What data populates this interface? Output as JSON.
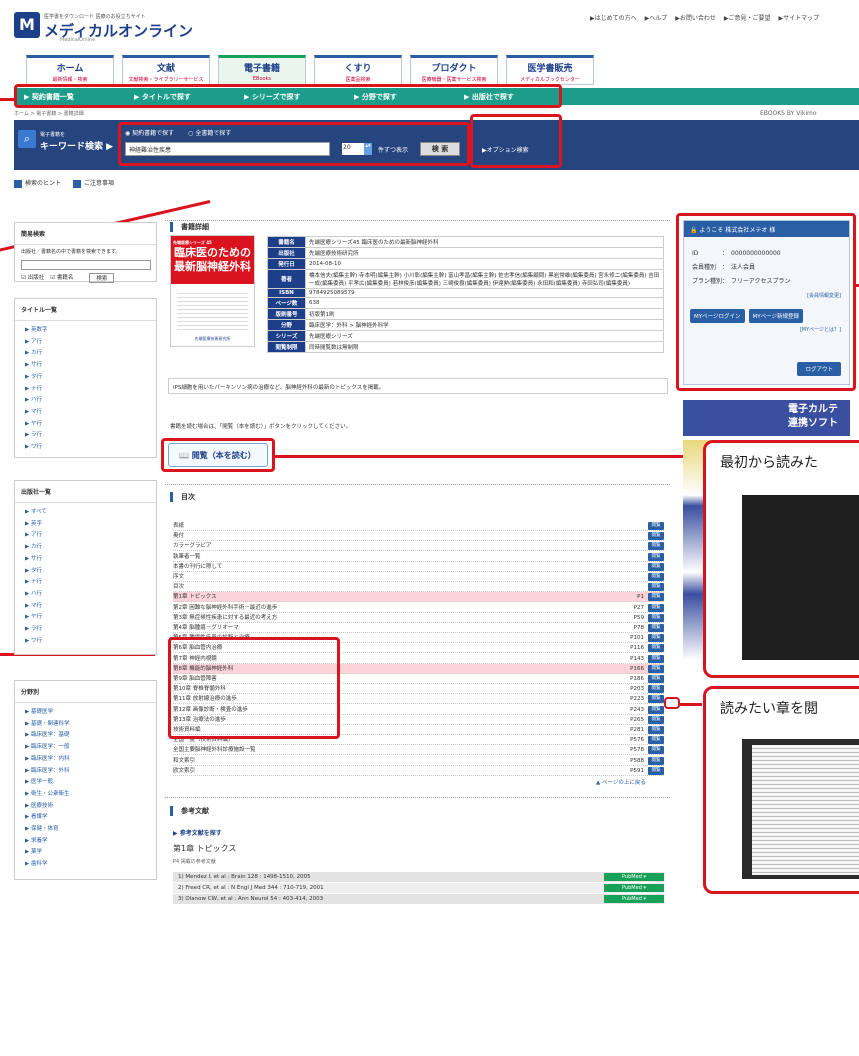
{
  "header": {
    "tagline": "医学書をダウンロード 医療のお役立ちサイト",
    "logo_mark": "M",
    "site_name": "メディカルオンライン",
    "site_sub": "MedicalOnline",
    "top_links": [
      "▶はじめての方へ",
      "▶ヘルプ",
      "▶お問い合わせ",
      "▶ご意見・ご要望",
      "▶サイトマップ"
    ]
  },
  "nav": {
    "tabs": [
      {
        "label": "ホーム",
        "sub": "最新情報・検索"
      },
      {
        "label": "文献",
        "sub": "文献検索・ライブラリーサービス"
      },
      {
        "label": "電子書籍",
        "sub": "EBooks"
      },
      {
        "label": "くすり",
        "sub": "医薬品検索"
      },
      {
        "label": "プロダクト",
        "sub": "医療機器・医薬サービス検索"
      },
      {
        "label": "医学書販売",
        "sub": "メディカルブックセンター"
      }
    ]
  },
  "subnav": [
    "▶ 契約書籍一覧",
    "▶ タイトルで探す",
    "▶ シリーズで探す",
    "▶ 分野で探す",
    "▶ 出版社で探す"
  ],
  "breadcrumb": "ホーム > 電子書籍 > 書籍詳細",
  "brand": "EBOOKS BY Vikimo",
  "search": {
    "label_small": "電子書籍を",
    "label": "キーワード検索 ▶",
    "radio1": "契約書籍で探す",
    "radio2": "全書籍で探す",
    "value": "神経難治性疾患",
    "count": "20",
    "perpage": "件ずつ表示",
    "button": "検 索",
    "option": "▶オプション検索"
  },
  "hints": [
    "検索のヒント",
    "ご注意事項"
  ],
  "sidebar": {
    "simple": {
      "title": "簡易検索",
      "desc": "出版社／書籍名の中で書籍を検索できます。",
      "chk1": "出版社",
      "chk2": "書籍名",
      "btn": "検索"
    },
    "title_list": {
      "title": "タイトル一覧",
      "items": [
        "▶ 英数字",
        "▶ ア行",
        "▶ カ行",
        "▶ サ行",
        "▶ タ行",
        "▶ ナ行",
        "▶ ハ行",
        "▶ マ行",
        "▶ ヤ行",
        "▶ ラ行",
        "▶ ワ行"
      ]
    },
    "publisher_list": {
      "title": "出版社一覧",
      "items": [
        "▶ すべて",
        "▶ 英字",
        "▶ ア行",
        "▶ カ行",
        "▶ サ行",
        "▶ タ行",
        "▶ ナ行",
        "▶ ハ行",
        "▶ マ行",
        "▶ ヤ行",
        "▶ ラ行",
        "▶ ワ行"
      ]
    },
    "field_list": {
      "title": "分野別",
      "items": [
        "▶ 基礎医学",
        "▶ 基礎・関連科学",
        "▶ 臨床医学：基礎",
        "▶ 臨床医学：一般",
        "▶ 臨床医学：内科",
        "▶ 臨床医学：外科",
        "▶ 医学一般",
        "▶ 衛生・公衆衛生",
        "▶ 医療技術",
        "▶ 看護学",
        "▶ 保健・体育",
        "▶ 栄養学",
        "▶ 薬学",
        "▶ 歯科学"
      ]
    }
  },
  "detail": {
    "section_title": "書籍詳細",
    "cover": {
      "series": "先端医療シリーズ 45",
      "title": "臨床医のための最新脳神経外科",
      "publisher": "先端医療技術研究所"
    },
    "rows": [
      {
        "k": "書籍名",
        "v": "先端医療シリーズ45 臨床医のための最新脳神経外科"
      },
      {
        "k": "出版社",
        "v": "先端医療技術研究所"
      },
      {
        "k": "発行日",
        "v": "2014-08-10"
      },
      {
        "k": "著者",
        "v": "橋本信夫(編集主幹) 寺本明(編集主幹) 小川彰(編集主幹) 富山孝昌(編集主幹) 佐志孝信(編集顧問) 黒岩常雄(編集委員) 宮永修二(編集委員) 吉田一成(編集委員) 平孝広(編集委員) 若林俊彦(編集委員) 三崎俊樹(編集委員) 伊達勲(編集委員) 永田和(編集委員) 寺田弘司(編集委員)"
      },
      {
        "k": "ISBN",
        "v": "9784925089579"
      },
      {
        "k": "ページ数",
        "v": "638"
      },
      {
        "k": "版刷番号",
        "v": "初版第1刷"
      },
      {
        "k": "分野",
        "v": "臨床医学：外科 > 脳神経外科学"
      },
      {
        "k": "シリーズ",
        "v": "先端医療シリーズ"
      },
      {
        "k": "閲覧制限",
        "v": "同時閲覧数は無制限"
      }
    ],
    "desc": "iPS細胞を用いたパーキンソン病の治療など、脳神経外科の最新のトピックスを掲載。",
    "note": "書籍を読む場合は、「閲覧（本を読む）」ボタンをクリックしてください。",
    "read_button": "閲覧（本を読む）"
  },
  "toc": {
    "title": "目次",
    "view_label": "閲覧",
    "rows": [
      {
        "t": "表紙",
        "p": ""
      },
      {
        "t": "奥付",
        "p": ""
      },
      {
        "t": "カラーグラビア",
        "p": ""
      },
      {
        "t": "執筆者一覧",
        "p": ""
      },
      {
        "t": "本書の刊行に際して",
        "p": ""
      },
      {
        "t": "序文",
        "p": ""
      },
      {
        "t": "目次",
        "p": ""
      },
      {
        "t": "第1章 トピックス",
        "p": "P1"
      },
      {
        "t": "第2章 困難な脳神経外科手術－最近の進歩",
        "p": "P27"
      },
      {
        "t": "第3章 無症候性疾患に対する最近の考え方",
        "p": "P59"
      },
      {
        "t": "第4章 脳腫瘍－グリオーマ",
        "p": "P78"
      },
      {
        "t": "第5章 腫瘍性疾患の診断と治療",
        "p": "P101"
      },
      {
        "t": "第6章 脳血管内治療",
        "p": "P116"
      },
      {
        "t": "第7章 神経内視鏡",
        "p": "P143"
      },
      {
        "t": "第8章 機能的脳神経外科",
        "p": "P166"
      },
      {
        "t": "第9章 脳血管障害",
        "p": "P186"
      },
      {
        "t": "第10章 脊椎脊髄外科",
        "p": "P203"
      },
      {
        "t": "第11章 放射線治療の進歩",
        "p": "P223"
      },
      {
        "t": "第12章 画像診断・検査の進歩",
        "p": "P243"
      },
      {
        "t": "第13章 治療法の進歩",
        "p": "P265"
      },
      {
        "t": "技術資料編",
        "p": "P281"
      },
      {
        "t": "全国一覧（技術資料編）",
        "p": "P576"
      },
      {
        "t": "全国主要脳神経外科診療施設一覧",
        "p": "P578"
      },
      {
        "t": "和文索引",
        "p": "P588"
      },
      {
        "t": "欧文索引",
        "p": "P591"
      }
    ],
    "back_to_top": "▲ ページの上に戻る"
  },
  "refs": {
    "title": "参考文献",
    "link": "▶ 参考文献を探す",
    "chapter": "第1章 トピックス",
    "sub": "P4 掲載の参考文献",
    "pubmed": "PubMed ▾",
    "rows": [
      "1) Mendez I, et al : Brain 128 : 1498-1510, 2005",
      "2) Freed CR, et al : N Engl J Med 344 : 710-719, 2001",
      "3) Olanow CW, et al : Ann Neurol 54 : 403-414, 2003"
    ]
  },
  "login": {
    "welcome": "ようこそ 株式会社メテオ 様",
    "id_label": "ID",
    "id_value": "：　0000000000000",
    "member_label": "会員種別",
    "member_value": "：　法人会員",
    "plan_label": "プラン種別",
    "plan_value": "：　フリーアクセスプラン",
    "change": "[会員情報変更]",
    "btn1": "MYページログイン",
    "btn2": "MYページ新規登録",
    "mypage": "[MYページとは？]",
    "logout": "ログアウト"
  },
  "ads": {
    "ad1_line1": "電子カルテ",
    "ad1_line2": "連携ソフト"
  },
  "callouts": {
    "c1": "最初から読みた",
    "c2": "読みたい章を閲"
  }
}
